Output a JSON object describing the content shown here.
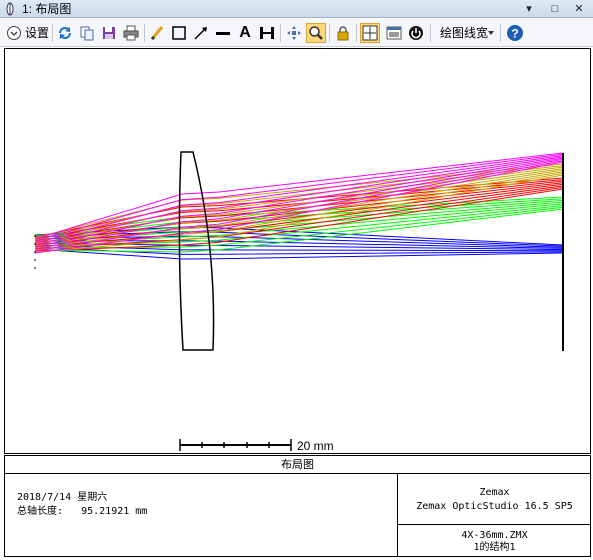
{
  "window": {
    "title": "1: 布局图",
    "controls": {
      "dropdown": "▾",
      "restore": "□",
      "close": "✕"
    }
  },
  "toolbar": {
    "settings_label": "设置",
    "line_width_label": "绘图线宽",
    "help_glyph": "?",
    "text_tool_glyph": "A"
  },
  "plot": {
    "scale_bar_label": "20 mm",
    "ray_colors": [
      "#0000ff",
      "#00ff00",
      "#ff0000",
      "#c8a800",
      "#ff00ff"
    ],
    "lens_color": "#000000"
  },
  "footer": {
    "caption": "布局图",
    "date": "2018/7/14 星期六",
    "axis_length_label": "总轴长度:",
    "axis_length_value": "95.21921 mm",
    "company": "Zemax",
    "program": "Zemax OpticStudio 16.5 SP5",
    "file": "4X-36mm.ZMX",
    "config": "1的结构1"
  }
}
